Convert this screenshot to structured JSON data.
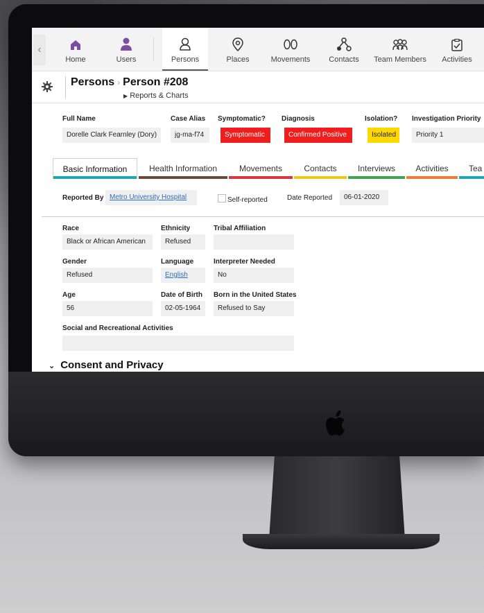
{
  "nav": {
    "items": [
      {
        "label": "Home",
        "icon": "home-icon"
      },
      {
        "label": "Users",
        "icon": "user-icon"
      },
      {
        "label": "Persons",
        "icon": "person-icon"
      },
      {
        "label": "Places",
        "icon": "location-pin-icon"
      },
      {
        "label": "Movements",
        "icon": "footprints-icon"
      },
      {
        "label": "Contacts",
        "icon": "network-icon"
      },
      {
        "label": "Team Members",
        "icon": "team-icon"
      },
      {
        "label": "Activities",
        "icon": "checklist-icon"
      }
    ],
    "active": "Persons",
    "accent": "#7b4ea3"
  },
  "breadcrumb": {
    "root": "Persons",
    "current": "Person #208",
    "sub": "Reports & Charts"
  },
  "header": {
    "full_name_label": "Full Name",
    "full_name": "Dorelle Clark Fearnley (Dory)",
    "case_alias_label": "Case Alias",
    "case_alias": "jg-ma-f74",
    "symptomatic_label": "Symptomatic?",
    "symptomatic": "Symptomatic",
    "diagnosis_label": "Diagnosis",
    "diagnosis": "Confirmed Positive",
    "isolation_label": "Isolation?",
    "isolation": "Isolated",
    "priority_label": "Investigation Priority",
    "priority": "Priority 1",
    "colors": {
      "red": "#f01d1d",
      "yellow": "#ffd800"
    }
  },
  "tabs": [
    {
      "label": "Basic Information",
      "color": "#20a7b0"
    },
    {
      "label": "Health Information",
      "color": "#6a4a3a"
    },
    {
      "label": "Movements",
      "color": "#d9363e"
    },
    {
      "label": "Contacts",
      "color": "#f0c419"
    },
    {
      "label": "Interviews",
      "color": "#3fa452"
    },
    {
      "label": "Activities",
      "color": "#f07a3a"
    },
    {
      "label": "Tea",
      "color": "#20a7b0"
    }
  ],
  "report": {
    "reported_by_label": "Reported By",
    "reported_by": "Metro University Hospital",
    "self_reported": "Self-reported",
    "date_reported_label": "Date Reported",
    "date_reported": "06-01-2020"
  },
  "demographics": {
    "race_label": "Race",
    "race": "Black or African American",
    "ethnicity_label": "Ethnicity",
    "ethnicity": "Refused",
    "tribal_label": "Tribal Affiliation",
    "tribal": "",
    "gender_label": "Gender",
    "gender": "Refused",
    "language_label": "Language",
    "language": "English",
    "interpreter_label": "Interpreter Needed",
    "interpreter": "No",
    "age_label": "Age",
    "age": "56",
    "dob_label": "Date of Birth",
    "dob": "02-05-1964",
    "born_us_label": "Born in the United States",
    "born_us": "Refused to Say",
    "social_label": "Social and Recreational Activities",
    "social": ""
  },
  "sections": {
    "consent": "Consent and Privacy"
  }
}
